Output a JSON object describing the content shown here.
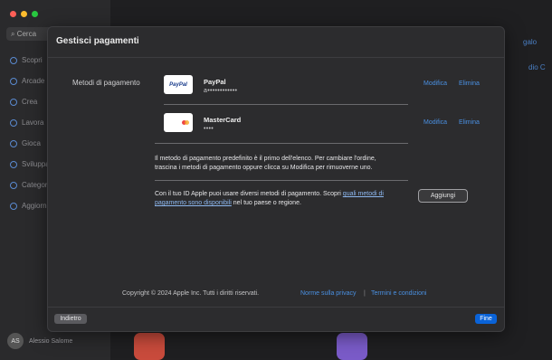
{
  "window": {
    "dots": [
      "#ff5f57",
      "#febc2e",
      "#28c840"
    ]
  },
  "sidebar": {
    "search_placeholder": "Cerca",
    "items": [
      "Scopri",
      "Arcade",
      "Crea",
      "Lavora",
      "Gioca",
      "Sviluppa",
      "Categorie",
      "Aggiornamenti"
    ],
    "user_initials": "AS",
    "user_name": "Alessio Salome"
  },
  "background": {
    "link_right_1": "galo",
    "link_right_2": "dio C"
  },
  "sheet": {
    "title": "Gestisci pagamenti",
    "section_label": "Metodi di pagamento",
    "methods": [
      {
        "name": "PayPal",
        "detail": "a••••••••••••",
        "logo": "PayPal",
        "edit": "Modifica",
        "remove": "Elimina"
      },
      {
        "name": "MasterCard",
        "detail": "••••",
        "logo": "mastercard-logo",
        "edit": "Modifica",
        "remove": "Elimina"
      }
    ],
    "info_text": "Il metodo di pagamento predefinito è il primo dell'elenco. Per cambiare l'ordine, trascina i metodi di pagamento oppure clicca su Modifica per rimuoverne uno.",
    "add_text_before": "Con il tuo ID Apple puoi usare diversi metodi di pagamento. Scopri ",
    "add_text_link": "quali metodi di pagamento sono disponibili",
    "add_text_after": " nel tuo paese o regione.",
    "add_button": "Aggiungi",
    "copyright": "Copyright © 2024 Apple Inc. Tutti i diritti riservati.",
    "privacy_link": "Norme sulla privacy",
    "separator": "|",
    "terms_link": "Termini e condizioni",
    "back_button": "Indietro",
    "done_button": "Fine"
  }
}
